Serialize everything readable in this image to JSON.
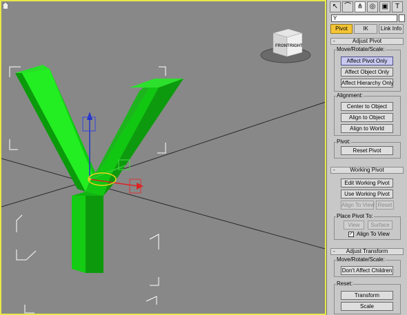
{
  "viewport": {
    "viewcube": {
      "front": "FRONT",
      "right": "RIGHT"
    },
    "icons": {
      "home": "home-icon"
    }
  },
  "command_panel": {
    "tab_icons": [
      "cursor-icon",
      "modify-icon",
      "hierarchy-icon",
      "motion-icon",
      "display-icon",
      "utilities-icon"
    ],
    "object_name": "Y",
    "tabs": [
      "Pivot",
      "IK",
      "Link Info"
    ],
    "active_tab": "Pivot",
    "adjust_pivot": {
      "title": "Adjust Pivot",
      "move_group_label": "Move/Rotate/Scale:",
      "affect_pivot_only": "Affect Pivot Only",
      "affect_object_only": "Affect Object Only",
      "affect_hierarchy_only": "Affect Hierarchy Only",
      "alignment_label": "Alignment:",
      "center_to_object": "Center to Object",
      "align_to_object": "Align to Object",
      "align_to_world": "Align to World",
      "pivot_label": "Pivot:",
      "reset_pivot": "Reset Pivot"
    },
    "working_pivot": {
      "title": "Working Pivot",
      "edit_working_pivot": "Edit Working Pivot",
      "use_working_pivot": "Use Working Pivot",
      "align_to_view": "Align To View",
      "reset": "Reset",
      "place_pivot_label": "Place Pivot To:",
      "view": "View",
      "surface": "Surface",
      "align_to_view_check": "Align To View",
      "align_to_view_checked": true
    },
    "adjust_transform": {
      "title": "Adjust Transform",
      "move_group_label": "Move/Rotate/Scale:",
      "dont_affect_children": "Don't Affect Children",
      "reset_label": "Reset:",
      "transform": "Transform",
      "scale": "Scale"
    }
  }
}
